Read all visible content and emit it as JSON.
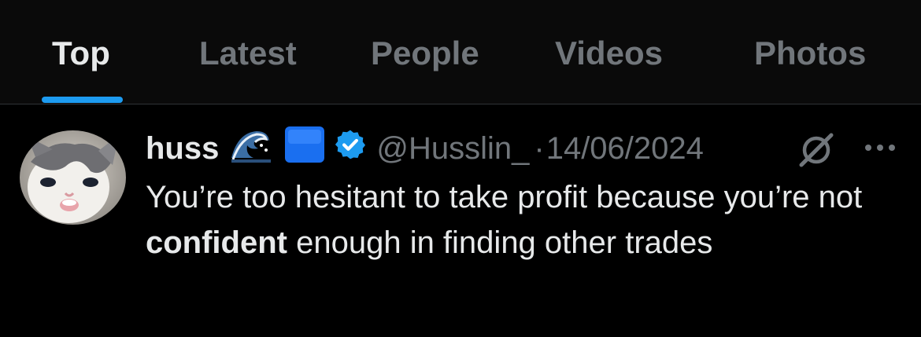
{
  "tabs": [
    {
      "label": "Top",
      "active": true
    },
    {
      "label": "Latest",
      "active": false
    },
    {
      "label": "People",
      "active": false
    },
    {
      "label": "Videos",
      "active": false
    },
    {
      "label": "Photos",
      "active": false
    }
  ],
  "colors": {
    "accent": "#1d9bf0",
    "background": "#000000",
    "muted_text": "#71767b",
    "primary_text": "#e7e9ea"
  },
  "tweet": {
    "author_name": "huss",
    "name_emojis": [
      "wave-emoji",
      "blue-square-emoji"
    ],
    "verified": true,
    "handle": "@Husslin_",
    "separator": "·",
    "date": "14/06/2024",
    "text_part1": "You’re too hesitant to take profit because you’re not ",
    "text_bold": "confident",
    "text_part2": " enough in finding other trades",
    "icons": [
      "grok-icon",
      "more-icon"
    ]
  }
}
